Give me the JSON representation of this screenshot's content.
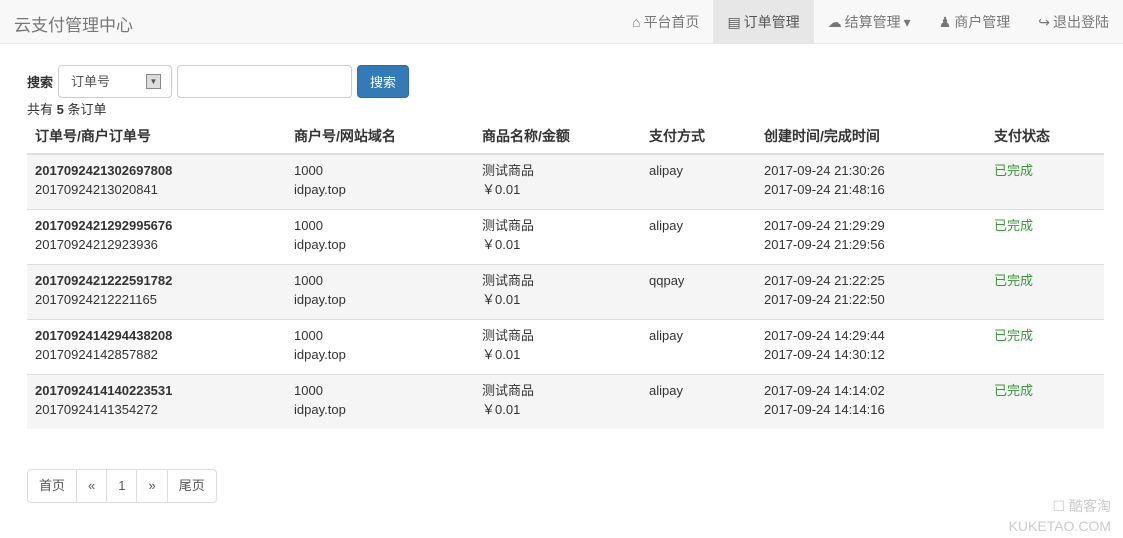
{
  "nav": {
    "brand": "云支付管理中心",
    "items": [
      {
        "icon": "home-icon",
        "glyph": "⌂",
        "label": "平台首页"
      },
      {
        "icon": "cart-icon",
        "glyph": "▤",
        "label": "订单管理",
        "active": true
      },
      {
        "icon": "cloud-icon",
        "glyph": "☁",
        "label": "结算管理",
        "caret": "▾"
      },
      {
        "icon": "user-icon",
        "glyph": "♟",
        "label": "商户管理"
      },
      {
        "icon": "logout-icon",
        "glyph": "↪",
        "label": "退出登陆"
      }
    ]
  },
  "search": {
    "label": "搜索",
    "select_value": "订单号",
    "input_value": "",
    "button": "搜索"
  },
  "count": {
    "prefix": "共有",
    "num": "5",
    "suffix": "条订单"
  },
  "table": {
    "headers": [
      "订单号/商户订单号",
      "商户号/网站域名",
      "商品名称/金额",
      "支付方式",
      "创建时间/完成时间",
      "支付状态"
    ],
    "rows": [
      {
        "order": "2017092421302697808",
        "out": "20170924213020841",
        "pid": "1000",
        "site": "idpay.top",
        "name": "测试商品",
        "money": "￥0.01",
        "type": "alipay",
        "ct": "2017-09-24 21:30:26",
        "et": "2017-09-24 21:48:16",
        "status": "已完成"
      },
      {
        "order": "2017092421292995676",
        "out": "20170924212923936",
        "pid": "1000",
        "site": "idpay.top",
        "name": "测试商品",
        "money": "￥0.01",
        "type": "alipay",
        "ct": "2017-09-24 21:29:29",
        "et": "2017-09-24 21:29:56",
        "status": "已完成"
      },
      {
        "order": "2017092421222591782",
        "out": "20170924212221165",
        "pid": "1000",
        "site": "idpay.top",
        "name": "测试商品",
        "money": "￥0.01",
        "type": "qqpay",
        "ct": "2017-09-24 21:22:25",
        "et": "2017-09-24 21:22:50",
        "status": "已完成"
      },
      {
        "order": "2017092414294438208",
        "out": "20170924142857882",
        "pid": "1000",
        "site": "idpay.top",
        "name": "测试商品",
        "money": "￥0.01",
        "type": "alipay",
        "ct": "2017-09-24 14:29:44",
        "et": "2017-09-24 14:30:12",
        "status": "已完成"
      },
      {
        "order": "2017092414140223531",
        "out": "20170924141354272",
        "pid": "1000",
        "site": "idpay.top",
        "name": "测试商品",
        "money": "￥0.01",
        "type": "alipay",
        "ct": "2017-09-24 14:14:02",
        "et": "2017-09-24 14:14:16",
        "status": "已完成"
      }
    ]
  },
  "pager": [
    "首页",
    "«",
    "1",
    "»",
    "尾页"
  ],
  "watermark": {
    "line1": "酷客淘",
    "line2": "KUKETAO.COM"
  }
}
